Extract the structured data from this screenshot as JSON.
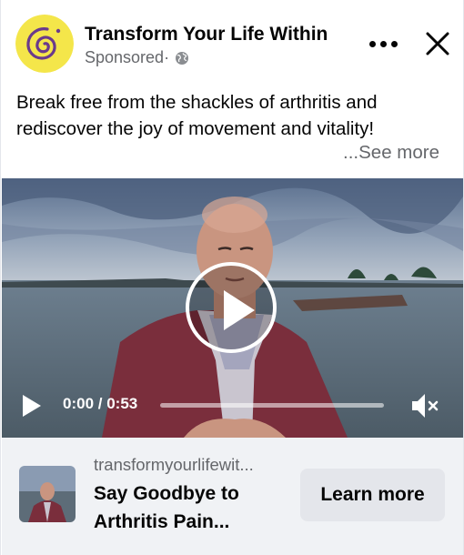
{
  "ad": {
    "page_name": "Transform Your Life Within",
    "sponsored_label": "Sponsored",
    "sponsored_separator": " ·",
    "caption_line1": "Break free from the shackles of arthritis and",
    "caption_line2": "rediscover the joy of movement and vitality!",
    "see_more": "...See more"
  },
  "video": {
    "current_time": "0:00",
    "time_separator": " / ",
    "duration": "0:53",
    "progress_fraction": 0.0,
    "muted": true
  },
  "link_preview": {
    "domain": "transformyourlifewit...",
    "headline": "Say Goodbye to Arthritis Pain...",
    "cta_label": "Learn more"
  },
  "colors": {
    "logo_yellow": "#f4e64a",
    "logo_purple": "#6a3a8c",
    "secondary_text": "#65676b",
    "footer_bg": "#f0f2f5",
    "button_bg": "#e4e6eb"
  },
  "icons": {
    "more": "more-horizontal-icon",
    "close": "close-icon",
    "audience": "globe-icon",
    "play": "play-icon",
    "mute": "speaker-muted-icon"
  }
}
